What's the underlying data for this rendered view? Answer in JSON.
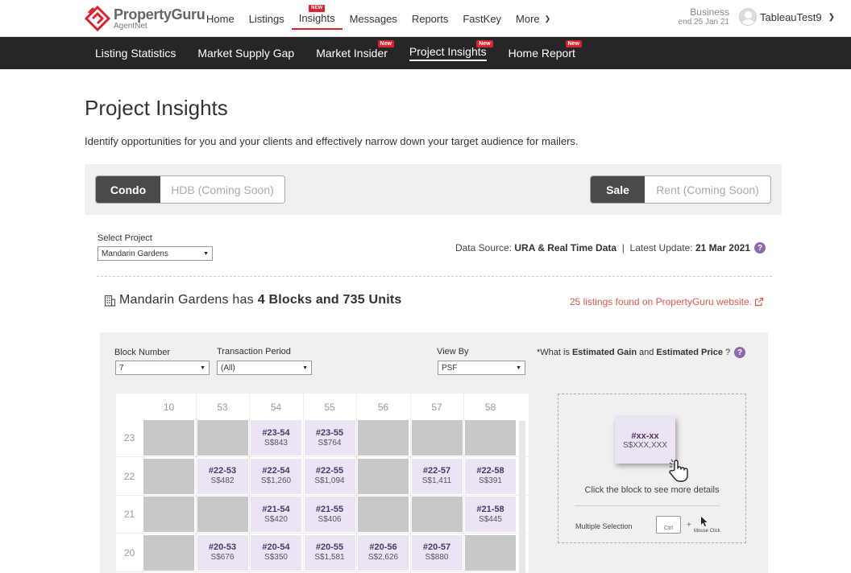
{
  "brand": {
    "name": "PropertyGuru",
    "sub": "AgentNet"
  },
  "nav": [
    {
      "label": "Home",
      "badge": ""
    },
    {
      "label": "Listings",
      "badge": ""
    },
    {
      "label": "Insights",
      "badge": "NEW"
    },
    {
      "label": "Messages",
      "badge": ""
    },
    {
      "label": "Reports",
      "badge": ""
    },
    {
      "label": "FastKey",
      "badge": ""
    },
    {
      "label": "More",
      "badge": ""
    }
  ],
  "account": {
    "type": "Business",
    "end": "end 25 Jan 21",
    "name": "TableauTest9"
  },
  "subnav": [
    {
      "label": "Listing Statistics",
      "badge": ""
    },
    {
      "label": "Market Supply Gap",
      "badge": ""
    },
    {
      "label": "Market Insider",
      "badge": "New"
    },
    {
      "label": "Project Insights",
      "badge": "New"
    },
    {
      "label": "Home Report",
      "badge": "New"
    }
  ],
  "page": {
    "title": "Project Insights",
    "description": "Identify opportunities for you and your clients and effectively narrow down your target audience for mailers."
  },
  "filters": {
    "type": {
      "active": "Condo",
      "inactive": "HDB (Coming Soon)"
    },
    "mode": {
      "active": "Sale",
      "inactive": "Rent (Coming Soon)"
    }
  },
  "project": {
    "select_label": "Select Project",
    "selected": "Mandarin Gardens",
    "data_source_label": "Data Source:",
    "data_source": "URA & Real Time Data",
    "sep": "|",
    "update_label": "Latest Update:",
    "update": "21 Mar 2021"
  },
  "summary": {
    "name": "Mandarin Gardens",
    "has": "has",
    "count": "4 Blocks and 735 Units",
    "listings_link": "25 listings found on PropertyGuru website."
  },
  "controls": {
    "block_label": "Block Number",
    "block_value": "7",
    "period_label": "Transaction Period",
    "period_value": "(All)",
    "view_label": "View By",
    "view_value": "PSF",
    "estimated": {
      "pre": "*What is",
      "gain": "Estimated Gain",
      "and": "and",
      "price": "Estimated Price",
      "post": "?"
    }
  },
  "grid": {
    "columns": [
      "10",
      "53",
      "54",
      "55",
      "56",
      "57",
      "58"
    ],
    "rows": [
      {
        "floor": "23",
        "cells": [
          null,
          null,
          {
            "unit": "#23-54",
            "price": "S$843"
          },
          {
            "unit": "#23-55",
            "price": "S$764"
          },
          null,
          null,
          null
        ]
      },
      {
        "floor": "22",
        "cells": [
          null,
          {
            "unit": "#22-53",
            "price": "S$482"
          },
          {
            "unit": "#22-54",
            "price": "S$1,260"
          },
          {
            "unit": "#22-55",
            "price": "S$1,094"
          },
          null,
          {
            "unit": "#22-57",
            "price": "S$1,411"
          },
          {
            "unit": "#22-58",
            "price": "S$391"
          }
        ]
      },
      {
        "floor": "21",
        "cells": [
          null,
          null,
          {
            "unit": "#21-54",
            "price": "S$420"
          },
          {
            "unit": "#21-55",
            "price": "S$406"
          },
          null,
          null,
          {
            "unit": "#21-58",
            "price": "S$445"
          }
        ]
      },
      {
        "floor": "20",
        "cells": [
          null,
          {
            "unit": "#20-53",
            "price": "S$676"
          },
          {
            "unit": "#20-54",
            "price": "S$350"
          },
          {
            "unit": "#20-55",
            "price": "S$1,581"
          },
          {
            "unit": "#20-56",
            "price": "S$2,626"
          },
          {
            "unit": "#20-57",
            "price": "S$880"
          },
          null
        ]
      }
    ]
  },
  "legend": {
    "unit": "#xx-xx",
    "price": "S$XXX,XXX",
    "hint": "Click the block to see more details",
    "multi": "Multiple Selection",
    "ctrl": "Ctrl",
    "plus": "+",
    "mouse": "Mouse Click"
  },
  "colors": {
    "brand_red": "#d9232d",
    "unit_fill": "#ece4f5",
    "empty_fill": "#c8c8c8",
    "link": "#e0574f",
    "help": "#8c6ab0"
  }
}
